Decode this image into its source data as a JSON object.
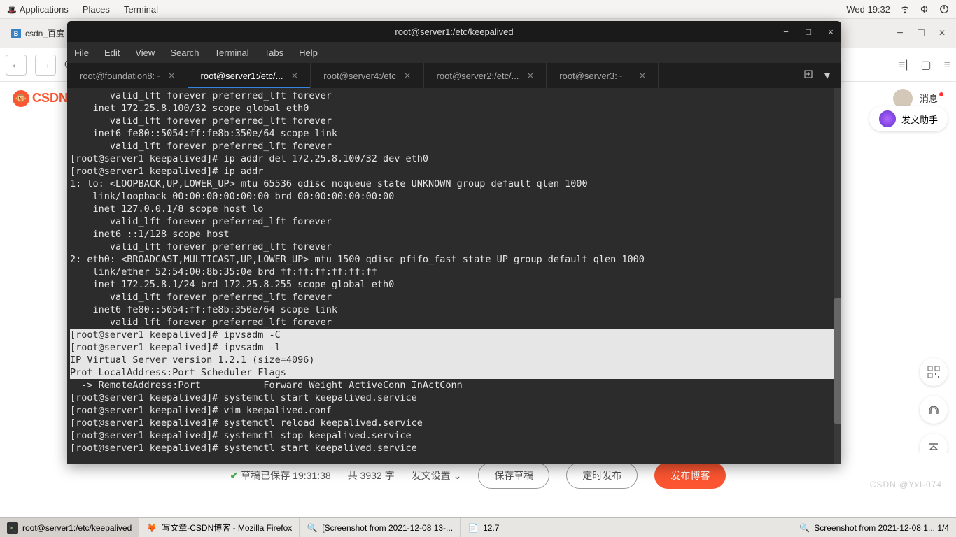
{
  "top_panel": {
    "applications": "Applications",
    "places": "Places",
    "terminal": "Terminal",
    "clock": "Wed 19:32"
  },
  "browser": {
    "tab_label": "csdn_百度",
    "csdn_brand": "CSDN",
    "message_label": "消息",
    "article_helper": "发文助手"
  },
  "editor_footer": {
    "draft_saved": "草稿已保存 19:31:38",
    "word_count": "共 3932 字",
    "publish_settings": "发文设置",
    "save_draft": "保存草稿",
    "schedule_publish": "定时发布",
    "publish_blog": "发布博客",
    "watermark": "CSDN @Yxl-074"
  },
  "terminal": {
    "title": "root@server1:/etc/keepalived",
    "menus": {
      "file": "File",
      "edit": "Edit",
      "view": "View",
      "search": "Search",
      "terminal": "Terminal",
      "tabs": "Tabs",
      "help": "Help"
    },
    "tabs": [
      {
        "label": "root@foundation8:~",
        "active": false
      },
      {
        "label": "root@server1:/etc/...",
        "active": true
      },
      {
        "label": "root@server4:/etc",
        "active": false
      },
      {
        "label": "root@server2:/etc/...",
        "active": false
      },
      {
        "label": "root@server3:~",
        "active": false
      }
    ],
    "body_top": "       valid_lft forever preferred_lft forever\n    inet 172.25.8.100/32 scope global eth0\n       valid_lft forever preferred_lft forever\n    inet6 fe80::5054:ff:fe8b:350e/64 scope link \n       valid_lft forever preferred_lft forever\n[root@server1 keepalived]# ip addr del 172.25.8.100/32 dev eth0\n[root@server1 keepalived]# ip addr\n1: lo: <LOOPBACK,UP,LOWER_UP> mtu 65536 qdisc noqueue state UNKNOWN group default qlen 1000\n    link/loopback 00:00:00:00:00:00 brd 00:00:00:00:00:00\n    inet 127.0.0.1/8 scope host lo\n       valid_lft forever preferred_lft forever\n    inet6 ::1/128 scope host \n       valid_lft forever preferred_lft forever\n2: eth0: <BROADCAST,MULTICAST,UP,LOWER_UP> mtu 1500 qdisc pfifo_fast state UP group default qlen 1000\n    link/ether 52:54:00:8b:35:0e brd ff:ff:ff:ff:ff:ff\n    inet 172.25.8.1/24 brd 172.25.8.255 scope global eth0\n       valid_lft forever preferred_lft forever\n    inet6 fe80::5054:ff:fe8b:350e/64 scope link \n       valid_lft forever preferred_lft forever",
    "body_highlight": "[root@server1 keepalived]# ipvsadm -C\n[root@server1 keepalived]# ipvsadm -l\nIP Virtual Server version 1.2.1 (size=4096)\nProt LocalAddress:Port Scheduler Flags",
    "body_bottom": "  -> RemoteAddress:Port           Forward Weight ActiveConn InActConn\n[root@server1 keepalived]# systemctl start keepalived.service \n[root@server1 keepalived]# vim keepalived.conf \n[root@server1 keepalived]# systemctl reload keepalived.service \n[root@server1 keepalived]# systemctl stop keepalived.service \n[root@server1 keepalived]# systemctl start keepalived.service "
  },
  "taskbar": {
    "items": [
      {
        "label": "root@server1:/etc/keepalived",
        "icon": "term",
        "active": true
      },
      {
        "label": "写文章-CSDN博客 - Mozilla Firefox",
        "icon": "ff",
        "active": false
      },
      {
        "label": "[Screenshot from 2021-12-08 13-...",
        "icon": "img",
        "active": false
      },
      {
        "label": "12.7",
        "icon": "doc",
        "active": false
      }
    ],
    "right_label": "Screenshot from 2021-12-08 1...  1/4"
  }
}
